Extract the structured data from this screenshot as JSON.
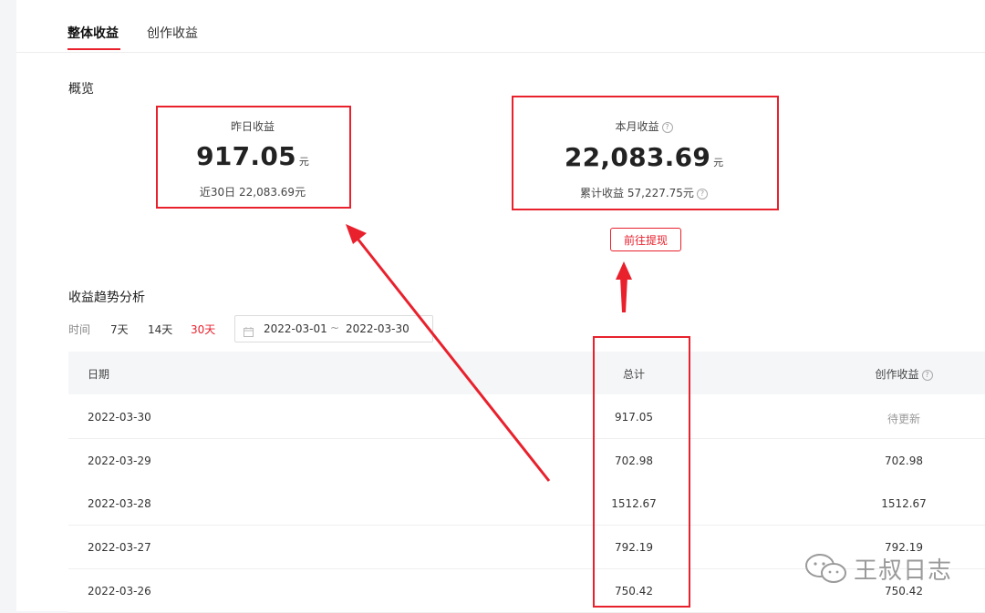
{
  "tabs": [
    {
      "label": "整体收益",
      "active": true
    },
    {
      "label": "创作收益",
      "active": false
    }
  ],
  "overview": {
    "title": "概览",
    "yesterday": {
      "label": "昨日收益",
      "value": "917.05",
      "unit": "元",
      "sub": "近30日 22,083.69元"
    },
    "month": {
      "label": "本月收益",
      "value": "22,083.69",
      "unit": "元",
      "sub": "累计收益 57,227.75元"
    },
    "withdraw_label": "前往提现"
  },
  "trend": {
    "title": "收益趋势分析",
    "time_label": "时间",
    "ranges": [
      {
        "label": "7天",
        "active": false
      },
      {
        "label": "14天",
        "active": false
      },
      {
        "label": "30天",
        "active": true
      }
    ],
    "date_start": "2022-03-01",
    "date_sep": "~",
    "date_end": "2022-03-30"
  },
  "table": {
    "columns": [
      "日期",
      "总计",
      "创作收益"
    ],
    "rows": [
      {
        "date": "2022-03-30",
        "total": "917.05",
        "creative": "待更新"
      },
      {
        "date": "2022-03-29",
        "total": "702.98",
        "creative": "702.98"
      },
      {
        "date": "2022-03-28",
        "total": "1512.67",
        "creative": "1512.67"
      },
      {
        "date": "2022-03-27",
        "total": "792.19",
        "creative": "792.19"
      },
      {
        "date": "2022-03-26",
        "total": "750.42",
        "creative": "750.42"
      }
    ]
  },
  "watermark": {
    "text": "王叔日志"
  },
  "colors": {
    "accent": "#e8212d",
    "text": "#222222",
    "muted": "#999999"
  }
}
